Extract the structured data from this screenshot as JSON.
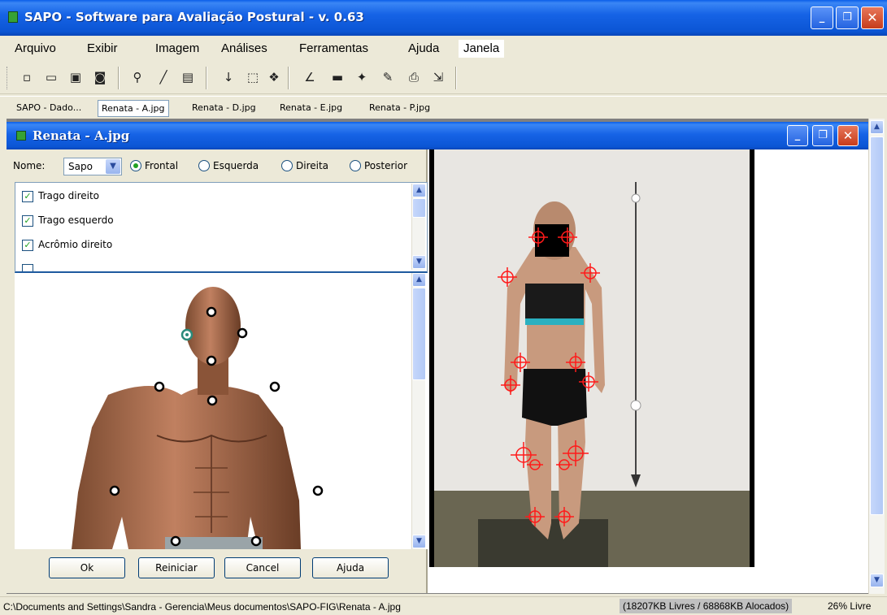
{
  "app": {
    "title": "SAPO - Software para Avaliação Postural - v. 0.63",
    "window_buttons": {
      "minimize": "_",
      "maximize": "❐",
      "close": "✕"
    }
  },
  "menu": {
    "items": [
      "Arquivo",
      "Exibir",
      "Imagem",
      "Análises",
      "Ferramentas",
      "Ajuda",
      "Janela"
    ]
  },
  "toolbar": {
    "icons": [
      "new-icon",
      "open-icon",
      "save-icon",
      "camera-icon",
      "zoom-icon",
      "pen-icon",
      "frame-icon",
      "arrow-down-icon",
      "crop-icon",
      "transform-icon",
      "angle-icon",
      "ruler-icon",
      "markers-icon",
      "edit-icon",
      "print-icon",
      "export-icon"
    ]
  },
  "tabs": {
    "items": [
      "SAPO - Dado...",
      "Renata - A.jpg",
      "Renata - D.jpg",
      "Renata - E.jpg",
      "Renata - P.jpg"
    ],
    "active": "Renata - A.jpg"
  },
  "child_window": {
    "title": "Renata - A.jpg"
  },
  "view_panel": {
    "nome_label": "Nome:",
    "nome_value": "Sapo",
    "views": [
      "Frontal",
      "Esquerda",
      "Direita",
      "Posterior"
    ],
    "selected_view": "Frontal"
  },
  "points": {
    "items": [
      {
        "label": "Trago direito",
        "checked": true
      },
      {
        "label": "Trago esquerdo",
        "checked": true
      },
      {
        "label": "Acrômio direito",
        "checked": true
      }
    ]
  },
  "buttons": {
    "ok": "Ok",
    "reset": "Reiniciar",
    "cancel": "Cancel",
    "help": "Ajuda"
  },
  "status": {
    "path": "C:\\Documents and Settings\\Sandra - Gerencia\\Meus documentos\\SAPO-FIG\\Renata - A.jpg",
    "memory": "(18207KB Livres / 68868KB Alocados)",
    "percent": "26% Livre"
  },
  "colors": {
    "titlebar_blue": "#0b55d4",
    "marker_red": "#ff1a1a",
    "check_green": "#21a121"
  }
}
